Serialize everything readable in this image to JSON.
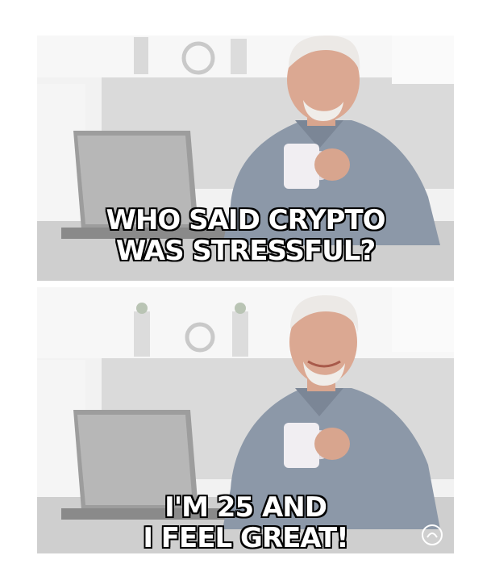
{
  "meme": {
    "top_caption": {
      "line1": "WHO SAID CRYPTO",
      "line2": "WAS STRESSFUL?"
    },
    "bottom_caption": {
      "line1": "I'M 25 AND",
      "line2": "I FEEL GREAT!"
    }
  },
  "colors": {
    "wall": "#e9e9e9",
    "counter": "#d4d4d4",
    "shirt": "#8c98a8",
    "skin": "#d8a58e",
    "hair": "#ece9e6",
    "mug": "#f1eef2",
    "laptop": "#9a9a9a"
  }
}
